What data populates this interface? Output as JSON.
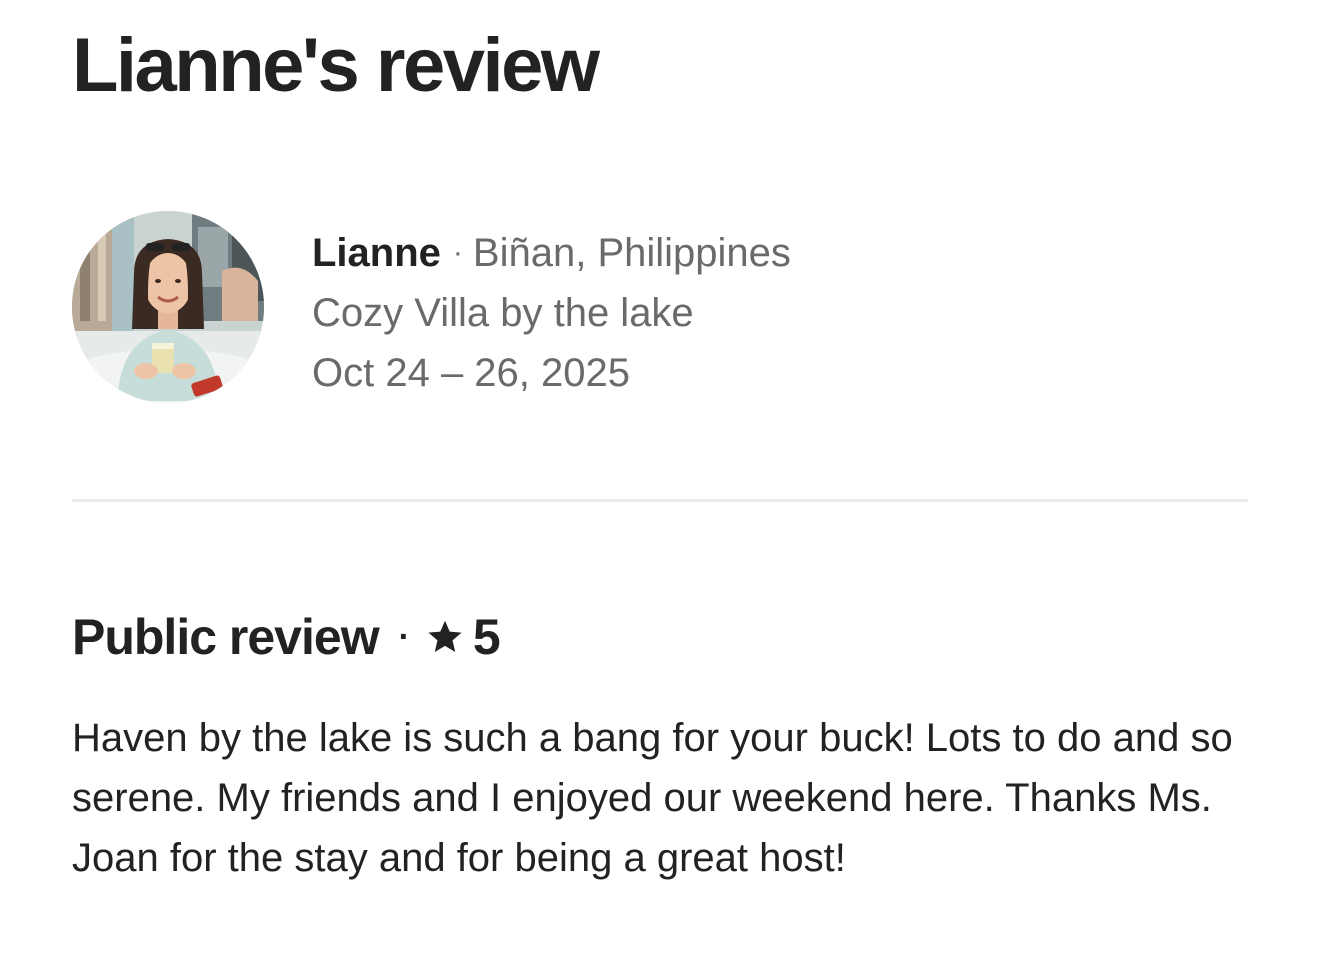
{
  "page": {
    "title": "Lianne's review"
  },
  "reviewer": {
    "name": "Lianne",
    "separator": "·",
    "location": "Biñan, Philippines",
    "listing": "Cozy Villa by the lake",
    "dates": "Oct 24 – 26, 2025",
    "avatar_icon": "profile-photo"
  },
  "review": {
    "heading": "Public review",
    "separator": "·",
    "star_icon": "star-icon",
    "rating": "5",
    "text": "Haven by the lake is such a bang for your buck! Lots to do and so serene. My friends and I enjoyed our weekend here. Thanks Ms. Joan for the stay and for being a great host!"
  },
  "colors": {
    "primary_text": "#222222",
    "secondary_text": "#6a6a6a",
    "divider": "#ebebeb"
  }
}
